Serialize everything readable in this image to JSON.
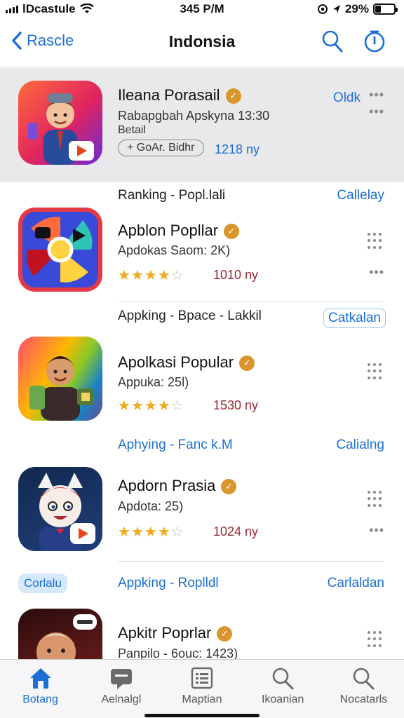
{
  "status": {
    "carrier": "lDcastule",
    "time": "345 P/M",
    "battery": "29%",
    "battery_level": 0.29
  },
  "nav": {
    "back_label": "Rascle",
    "title": "Indonsia"
  },
  "featured": {
    "name": "Ileana Porasail",
    "subtitle": "Rabapgbah Apskyna 13:30",
    "subtitle2": "Betail",
    "badge": "+ GoAr. Bidhr",
    "count": "1218 ny",
    "action": "Oldk"
  },
  "sections": [
    {
      "heading": "Ranking - Popl.lali",
      "link": "Callelay",
      "app": {
        "name": "Apblon Popllar",
        "subtitle": "Apdokas Saom: 2K)",
        "count": "1010 ny",
        "rating": 4
      }
    },
    {
      "heading": "Appking - Bpace - Lakkil",
      "link": "Catkalan",
      "app": {
        "name": "Apolkasi Popular",
        "subtitle": "Appuka: 25l)",
        "count": "1530 ny",
        "rating": 4
      }
    },
    {
      "heading": "Aphying - Fanc k.M",
      "link": "Calialng",
      "app": {
        "name": "Apdorn Prasia",
        "subtitle": "Apdota: 25)",
        "count": "1024 ny",
        "rating": 4
      }
    },
    {
      "heading": "Appking - Roplldl",
      "link": "Carlaldan",
      "chip": "Corlalu",
      "app": {
        "name": "Apkitr Poprlar",
        "subtitle": "Panpilo - 6ouc: 1423)"
      }
    }
  ],
  "tabs": [
    {
      "label": "Botang",
      "icon": "home-icon"
    },
    {
      "label": "Aelnalgl",
      "icon": "chat-icon"
    },
    {
      "label": "Maptian",
      "icon": "list-icon"
    },
    {
      "label": "Ikoanian",
      "icon": "search-icon"
    },
    {
      "label": "Nocatarls",
      "icon": "search-icon"
    }
  ],
  "colors": {
    "accent": "#1c6fd6",
    "verified": "#d9962b",
    "star": "#f2a91c",
    "count": "#9b2a35"
  }
}
